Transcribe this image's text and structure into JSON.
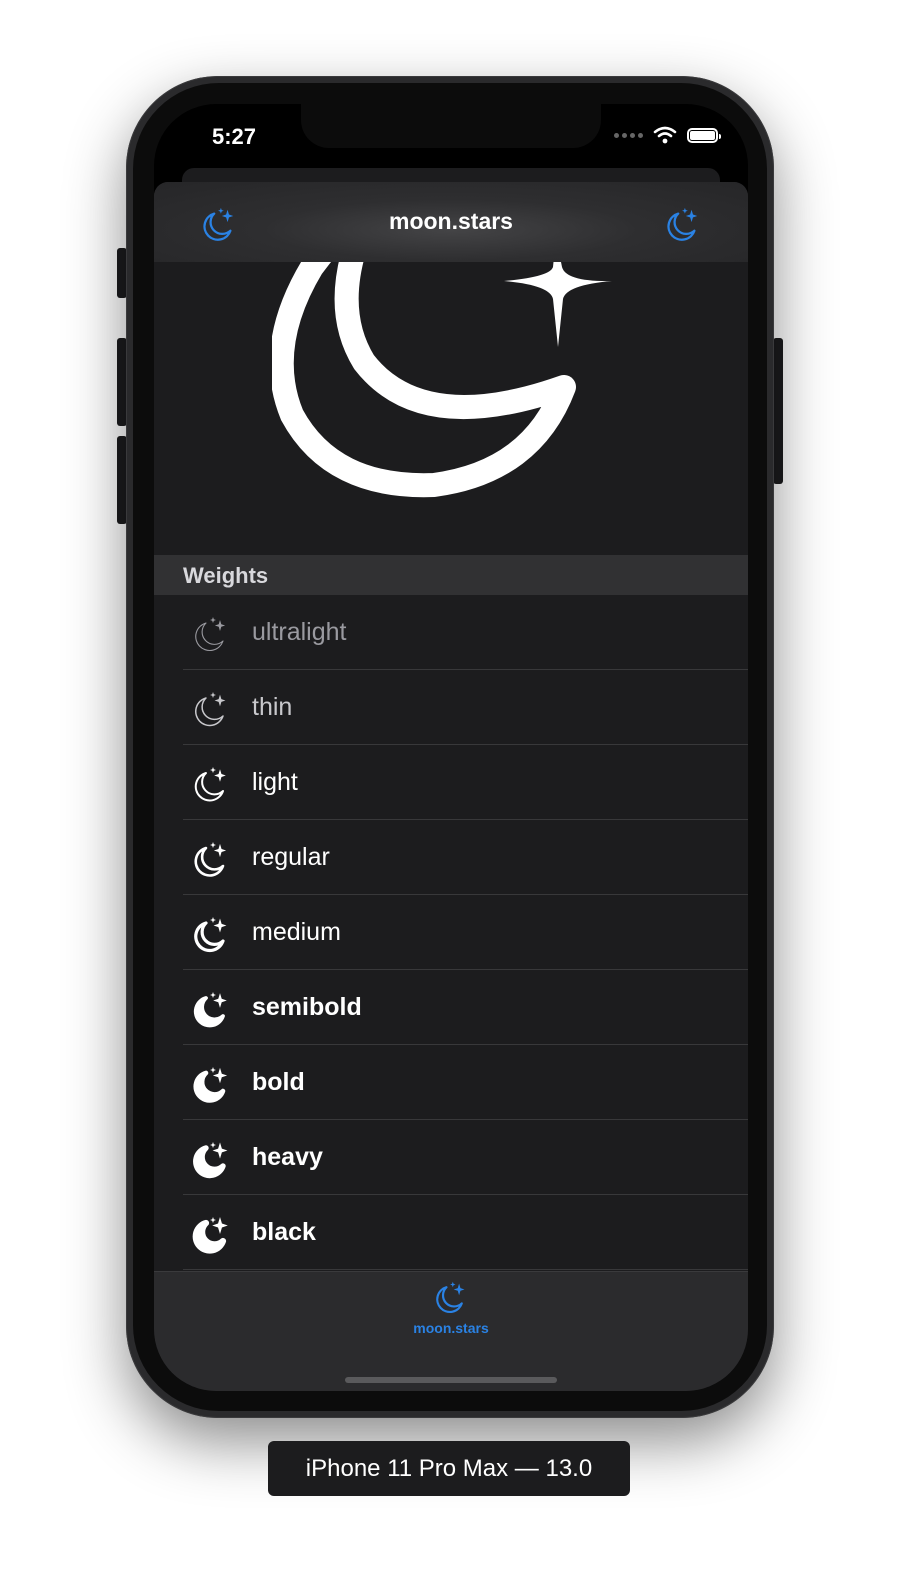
{
  "status_bar": {
    "time": "5:27"
  },
  "nav": {
    "title": "moon.stars",
    "left_icon": "moon-stars-icon",
    "right_icon": "moon-stars-icon",
    "tint": "#2a82e4"
  },
  "hero_icon": "moon-stars-icon",
  "section": {
    "title": "Weights"
  },
  "weights": [
    {
      "label": "ultralight",
      "color": "#9a9aa0",
      "weight": 100,
      "stroke": 1.1
    },
    {
      "label": "thin",
      "color": "#c8c8cc",
      "weight": 200,
      "stroke": 1.5
    },
    {
      "label": "light",
      "color": "#ffffff",
      "weight": 300,
      "stroke": 2.0
    },
    {
      "label": "regular",
      "color": "#ffffff",
      "weight": 400,
      "stroke": 2.6
    },
    {
      "label": "medium",
      "color": "#ffffff",
      "weight": 500,
      "stroke": 3.2
    },
    {
      "label": "semibold",
      "color": "#ffffff",
      "weight": 600,
      "stroke": 3.8
    },
    {
      "label": "bold",
      "color": "#ffffff",
      "weight": 700,
      "stroke": 4.6
    },
    {
      "label": "heavy",
      "color": "#ffffff",
      "weight": 800,
      "stroke": 5.4
    },
    {
      "label": "black",
      "color": "#ffffff",
      "weight": 900,
      "stroke": 6.2
    }
  ],
  "tab_bar": {
    "items": [
      {
        "label": "moon.stars",
        "icon": "moon-stars-icon",
        "selected": true
      }
    ]
  },
  "device_label": "iPhone 11 Pro Max — 13.0"
}
